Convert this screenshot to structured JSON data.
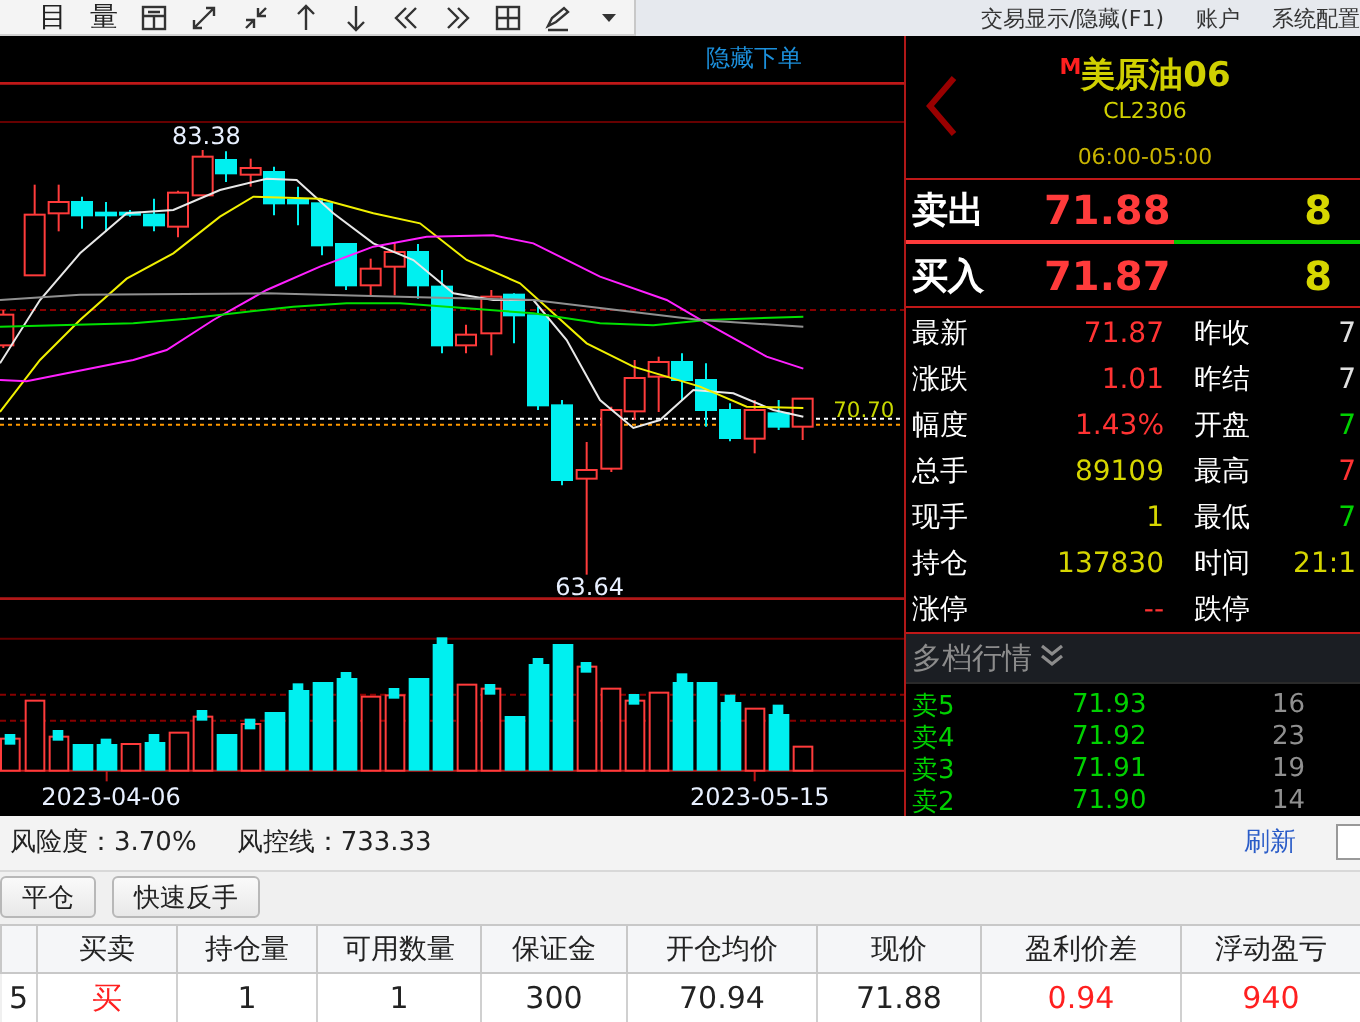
{
  "toolbar": {
    "glyphs": [
      "目",
      "量"
    ]
  },
  "menu": [
    "交易显示/隐藏(F1)",
    "账户",
    "系统配置"
  ],
  "chart": {
    "hide_order_link": "隐藏下单",
    "high_label": "83.38",
    "low_label": "63.64",
    "price_label": "70.70",
    "dates": [
      "2023-04-06",
      "2023-05-15"
    ]
  },
  "quote": {
    "badge": "M",
    "name": "美原油06",
    "code": "CL2306",
    "session": "06:00-05:00",
    "ask": {
      "label": "卖出",
      "price": "71.88",
      "volume": "8"
    },
    "ratio_bar": {
      "level": 0.59
    },
    "bid": {
      "label": "买入",
      "price": "71.87",
      "volume": "8"
    },
    "stats": [
      {
        "left": {
          "label": "最新",
          "value": "71.87",
          "color": "#ff3333"
        },
        "right": {
          "label": "昨收",
          "value": "7",
          "color": "#e0e0e0"
        }
      },
      {
        "left": {
          "label": "涨跌",
          "value": "1.01",
          "color": "#ff3333"
        },
        "right": {
          "label": "昨结",
          "value": "7",
          "color": "#e0e0e0"
        }
      },
      {
        "left": {
          "label": "幅度",
          "value": "1.43%",
          "color": "#ff3333"
        },
        "right": {
          "label": "开盘",
          "value": "7",
          "color": "#00d000"
        }
      },
      {
        "left": {
          "label": "总手",
          "value": "89109",
          "color": "#d6d600"
        },
        "right": {
          "label": "最高",
          "value": "7",
          "color": "#ff3333"
        }
      },
      {
        "left": {
          "label": "现手",
          "value": "1",
          "color": "#d6d600"
        },
        "right": {
          "label": "最低",
          "value": "7",
          "color": "#00d000"
        }
      },
      {
        "left": {
          "label": "持仓",
          "value": "137830",
          "color": "#d6d600"
        },
        "right": {
          "label": "时间",
          "value": "21:1",
          "color": "#d6d600"
        }
      },
      {
        "left": {
          "label": "涨停",
          "value": "--",
          "color": "#ff3333"
        },
        "right": {
          "label": "跌停"
        }
      }
    ]
  },
  "depth": {
    "title": "多档行情",
    "rows": [
      {
        "label": "卖5",
        "price": "71.93",
        "volume": "16"
      },
      {
        "label": "卖4",
        "price": "71.92",
        "volume": "23"
      },
      {
        "label": "卖3",
        "price": "71.91",
        "volume": "19"
      },
      {
        "label": "卖2",
        "price": "71.90",
        "volume": "14"
      }
    ]
  },
  "account": {
    "risk": "风险度：3.70%",
    "control_line": "风控线：733.33",
    "refresh": "刷新"
  },
  "actions": [
    "平仓",
    "快速反手"
  ],
  "positions": {
    "columns": [
      "",
      "买卖",
      "持仓量",
      "可用数量",
      "保证金",
      "开仓均价",
      "现价",
      "盈利价差",
      "浮动盈亏"
    ],
    "rows": [
      {
        "cells": [
          {
            "text": "5",
            "kind": "plain"
          },
          {
            "text": "买",
            "kind": "up"
          },
          {
            "text": "1",
            "kind": "plain"
          },
          {
            "text": "1",
            "kind": "plain"
          },
          {
            "text": "300",
            "kind": "plain"
          },
          {
            "text": "70.94",
            "kind": "plain"
          },
          {
            "text": "71.88",
            "kind": "plain"
          },
          {
            "text": "0.94",
            "kind": "up"
          },
          {
            "text": "940",
            "kind": "up"
          }
        ]
      }
    ]
  }
}
